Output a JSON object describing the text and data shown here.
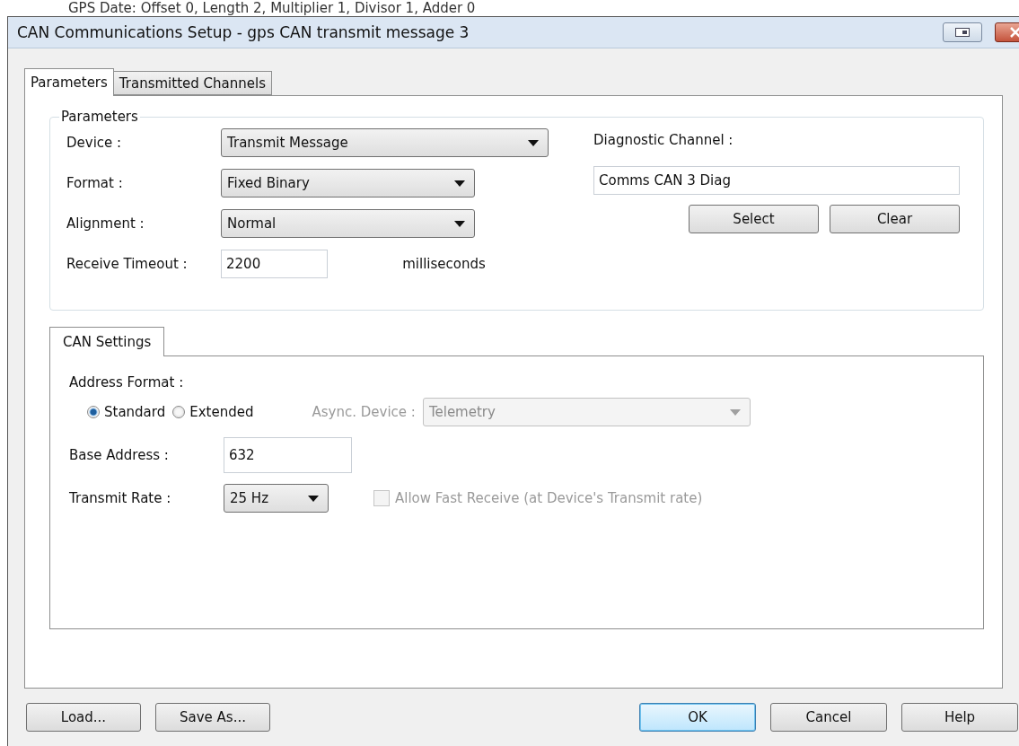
{
  "background_text": "GPS Date: Offset 0, Length 2, Multiplier 1, Divisor 1, Adder 0",
  "window": {
    "title": "CAN Communications Setup - gps CAN transmit message 3"
  },
  "tabs": [
    {
      "label": "Parameters",
      "selected": true
    },
    {
      "label": "Transmitted Channels",
      "selected": false
    }
  ],
  "parameters": {
    "title": "Parameters",
    "device": {
      "label": "Device :",
      "value": "Transmit Message"
    },
    "format": {
      "label": "Format :",
      "value": "Fixed Binary"
    },
    "alignment": {
      "label": "Alignment :",
      "value": "Normal"
    },
    "receive_timeout": {
      "label": "Receive Timeout :",
      "value": "2200",
      "unit": "milliseconds"
    },
    "diagnostic_channel": {
      "label": "Diagnostic Channel :",
      "value": "Comms CAN 3 Diag"
    },
    "buttons": [
      "Select",
      "Clear"
    ]
  },
  "can_settings": {
    "tab": {
      "label": "CAN Settings",
      "selected": true
    },
    "address_format": {
      "label": "Address Format :",
      "options": [
        {
          "label": "Standard",
          "selected": true
        },
        {
          "label": "Extended",
          "selected": false
        }
      ]
    },
    "async_device": {
      "label": "Async. Device :",
      "value": "Telemetry",
      "disabled": true
    },
    "base_address": {
      "label": "Base Address :",
      "value": "632"
    },
    "transmit_rate": {
      "label": "Transmit Rate :",
      "value": "25 Hz"
    },
    "allow_fast_receive": {
      "label": "Allow Fast Receive (at Device's Transmit rate)",
      "checked": false,
      "disabled": true
    }
  },
  "footer_left": [
    "Load...",
    "Save As..."
  ],
  "footer_right": [
    {
      "label": "OK",
      "default": true
    },
    {
      "label": "Cancel",
      "default": false
    },
    {
      "label": "Help",
      "default": false
    }
  ]
}
